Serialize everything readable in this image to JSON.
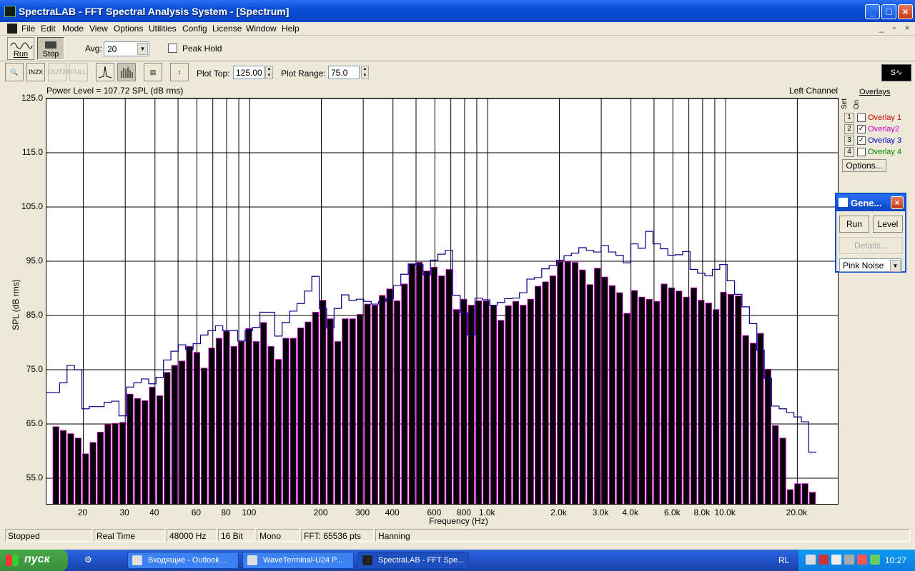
{
  "window": {
    "title": "SpectraLAB - FFT Spectral Analysis System - [Spectrum]"
  },
  "menu": [
    "File",
    "Edit",
    "Mode",
    "View",
    "Options",
    "Utilities",
    "Config",
    "License",
    "Window",
    "Help"
  ],
  "toolbar": {
    "run_label": "Run",
    "stop_label": "Stop",
    "avg_label": "Avg:",
    "avg_value": "20",
    "peak_hold_label": "Peak Hold",
    "plot_top_label": "Plot Top:",
    "plot_top_value": "125.00",
    "plot_range_label": "Plot Range:",
    "plot_range_value": "75.0"
  },
  "plot": {
    "power_level": "Power Level = 107.72 SPL (dB rms)",
    "channel": "Left Channel",
    "y_title": "SPL (dB rms)",
    "x_title": "Frequency (Hz)"
  },
  "chart_data": {
    "type": "bar",
    "ylabel": "SPL (dB rms)",
    "xlabel": "Frequency (Hz)",
    "ylim": [
      50,
      125
    ],
    "xlim": [
      14,
      30000
    ],
    "x_scale": "log",
    "y_ticks": [
      "125.0",
      "115.0",
      "105.0",
      "95.0",
      "85.0",
      "75.0",
      "65.0",
      "55.0"
    ],
    "x_ticks": [
      "20",
      "30",
      "40",
      "60",
      "80",
      "100",
      "200",
      "300",
      "400",
      "600",
      "800",
      "1.0k",
      "2.0k",
      "3.0k",
      "4.0k",
      "6.0k",
      "8.0k",
      "10.0k",
      "20.0k"
    ],
    "grid": true,
    "series": [
      {
        "values": [
          64.5,
          63.8,
          63.2,
          62.4,
          59.5,
          61.6,
          63.5,
          64.9,
          65.1,
          65.3,
          70.5,
          69.7,
          69.3,
          71.8,
          70.2,
          74.5,
          75.8,
          76.6,
          79.3,
          78.2,
          75.3,
          79.0,
          80.8,
          82.1,
          79.3,
          80.2,
          82.6,
          80.2,
          83.7,
          79.3,
          76.9,
          80.8,
          80.8,
          82.7,
          83.8,
          85.6,
          87.8,
          84.4,
          80.2,
          84.4,
          84.4,
          85.2,
          87.1,
          86.9,
          88.7,
          89.9,
          87.7,
          90.8,
          94.5,
          94.8,
          93.2,
          93.9,
          92.3,
          93.5,
          86.1,
          88.0,
          86.9,
          87.7,
          87.7,
          86.9,
          84.1,
          86.8,
          87.6,
          86.9,
          88.0,
          90.4,
          91.2,
          92.3,
          94.9,
          94.9,
          94.8,
          93.4,
          90.7,
          93.7,
          92.1,
          90.5,
          89.2,
          85.4,
          89.6,
          88.4,
          88.0,
          87.6,
          90.8,
          90.1,
          89.5,
          88.4,
          90.1,
          87.8,
          87.3,
          86.1,
          89.3,
          88.9,
          88.6,
          81.3,
          79.9,
          81.7,
          75.1,
          64.7,
          62.4,
          52.9,
          54.0,
          54.0,
          52.4
        ]
      },
      {
        "values": [
          70.8,
          72.6,
          75.8,
          75.0,
          67.8,
          68.2,
          68.2,
          69.0,
          69.2,
          66.5,
          71.8,
          72.6,
          73.3,
          72.4,
          73.6,
          76.8,
          78.4,
          79.6,
          78.7,
          79.8,
          81.4,
          82.2,
          83.1,
          82.2,
          82.2,
          80.3,
          82.2,
          82.8,
          85.6,
          85.6,
          81.2,
          83.7,
          85.8,
          87.2,
          89.5,
          92.2,
          86.3,
          82.7,
          86.3,
          88.8,
          87.8,
          88.0,
          87.6,
          87.1,
          87.6,
          88.1,
          90.5,
          92.6,
          94.5,
          94.4,
          92.5,
          95.2,
          96.3,
          97.0,
          88.7,
          85.5,
          81.4,
          88.2,
          87.9,
          86.9,
          87.4,
          88.1,
          88.2,
          89.2,
          91.7,
          92.0,
          93.6,
          94.2,
          95.2,
          96.0,
          96.5,
          97.5,
          97.0,
          96.7,
          97.9,
          96.7,
          96.1,
          94.7,
          98.2,
          97.4,
          100.5,
          98.2,
          97.3,
          96.1,
          96.2,
          96.8,
          93.5,
          92.8,
          92.3,
          93.5,
          94.4,
          91.4,
          88.9,
          86.6,
          83.5,
          78.6,
          73.4,
          68.3,
          67.8,
          67.1,
          66.3,
          65.4,
          59.8
        ]
      }
    ]
  },
  "overlays": {
    "title": "Overlays",
    "set_label": "Set",
    "on_label": "On",
    "items": [
      {
        "num": "1",
        "name": "Overlay 1",
        "checked": "",
        "color": "#cc0000"
      },
      {
        "num": "2",
        "name": "Overlay2",
        "checked": "✓",
        "color": "#cc00cc"
      },
      {
        "num": "3",
        "name": "Overlay 3",
        "checked": "✓",
        "color": "#0000cc"
      },
      {
        "num": "4",
        "name": "Overlay 4",
        "checked": "",
        "color": "#008800"
      }
    ],
    "options_label": "Options..."
  },
  "generator": {
    "title": "Gene...",
    "run_label": "Run",
    "level_label": "Level",
    "details_label": "Details...",
    "signal": "Pink Noise"
  },
  "status": [
    "Stopped",
    "Real Time",
    "48000 Hz",
    "16 Bit",
    "Mono",
    "FFT: 65536 pts",
    "Hanning"
  ],
  "taskbar": {
    "start_label": "пуск",
    "tasks": [
      "Входящие - Outlook ...",
      "WaveTerminal-U24 P...",
      "SpectraLAB - FFT Spe..."
    ],
    "lang": "RL",
    "clock": "10:27"
  }
}
